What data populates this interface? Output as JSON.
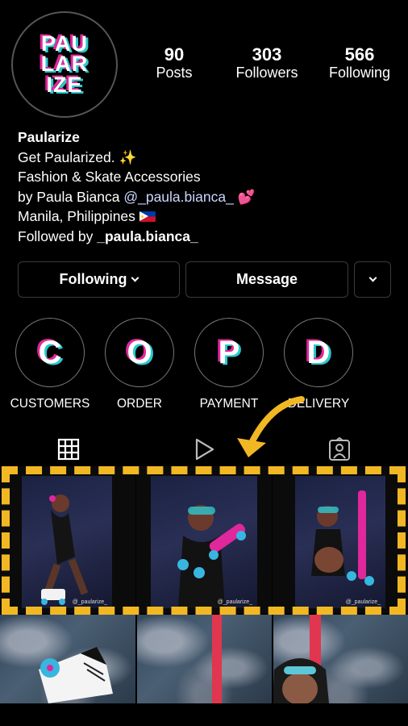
{
  "profile": {
    "logo_lines": [
      "PAU",
      "LAR",
      "IZE"
    ],
    "posts_count": "90",
    "posts_label": "Posts",
    "followers_count": "303",
    "followers_label": "Followers",
    "following_count": "566",
    "following_label": "Following",
    "name": "Paularize",
    "bio_line1": "Get Paularized. ✨",
    "bio_line2": "Fashion & Skate Accessories",
    "bio_line3_prefix": "by Paula Bianca ",
    "bio_line3_mention": "@_paula.bianca_",
    "bio_line3_emoji": " 💕",
    "bio_line4": "Manila, Philippines ",
    "followed_by_prefix": "Followed by ",
    "followed_by_user": "_paula.bianca_"
  },
  "actions": {
    "following_label": "Following",
    "message_label": "Message"
  },
  "highlights": [
    {
      "letter": "C",
      "label": "CUSTOMERS"
    },
    {
      "letter": "O",
      "label": "ORDER"
    },
    {
      "letter": "P",
      "label": "PAYMENT"
    },
    {
      "letter": "D",
      "label": "DELIVERY"
    }
  ],
  "tabs": [
    "grid-icon",
    "reels-icon",
    "tagged-icon"
  ],
  "posts": {
    "watermark": "@_paularize_"
  },
  "colors": {
    "highlight_dash": "#f2b824",
    "arrow": "#f2b824",
    "logo_pink": "#e0279b",
    "logo_cyan": "#2ec8cf"
  }
}
